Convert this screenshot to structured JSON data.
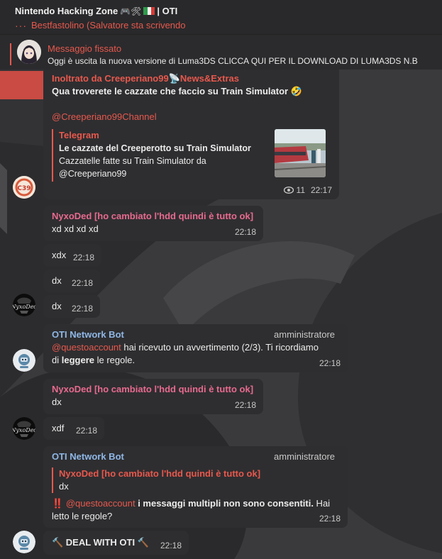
{
  "header": {
    "title": "Nintendo Hacking Zone",
    "title_emoji": "🎮🛠",
    "title_suffix": "| OTI",
    "typing_dots": "···",
    "typing_text": "Bestfastolino (Salvatore sta scrivendo"
  },
  "pinned": {
    "label": "Messaggio fissato",
    "text": "Oggi è uscita la nuova versione di Luma3DS  CLICCA QUI PER IL DOWNLOAD DI LUMA3DS  N.B"
  },
  "messages": {
    "forward": {
      "from": "Inoltrato da Creeperiano99📡News&Extras",
      "text": "Qua troverete le cazzate che faccio su Train Simulator 🤣",
      "channel": "@Creeperiano99Channel",
      "preview_site": "Telegram",
      "preview_title": "Le cazzate del Creeperotto su Train Simulator",
      "preview_desc": "Cazzatelle fatte su Train Simulator da @Creeperiano99",
      "views": "11",
      "time": "22:17"
    },
    "m1": {
      "sender": "NyxoDed [ho cambiato l'hdd quindi è tutto ok]",
      "text": "xd xd xd xd",
      "time": "22:18"
    },
    "m2": {
      "text": "xdx",
      "time": "22:18"
    },
    "m3": {
      "text": "dx",
      "time": "22:18"
    },
    "m4": {
      "text": "dx",
      "time": "22:18"
    },
    "bot1": {
      "sender": "OTI Network Bot",
      "role": "amministratore",
      "mention": "@questoaccount",
      "text_a": " hai ricevuto un avvertimento (2/3). Ti ricordiamo",
      "text_b": "di ",
      "bold": "leggere",
      "text_c": " le regole.",
      "time": "22:18"
    },
    "m5": {
      "sender": "NyxoDed [ho cambiato l'hdd quindi è tutto ok]",
      "text": "dx",
      "time": "22:18"
    },
    "m6": {
      "text": "xdf",
      "time": "22:18"
    },
    "bot2": {
      "sender": "OTI Network Bot",
      "role": "amministratore",
      "reply_sender": "NyxoDed [ho cambiato l'hdd quindi è tutto ok]",
      "reply_text": "dx",
      "alert": "‼️",
      "mention": "@questoaccount",
      "bold": " i messaggi multipli non sono consentiti.",
      "text_a": " Hai",
      "text_b": "letto le regole?",
      "time": "22:18"
    },
    "m7": {
      "text": "🔨 DEAL WITH OTI 🔨",
      "time": "22:18"
    }
  },
  "colors": {
    "accent": "#e8584d",
    "pink": "#e86a8f",
    "bot_blue": "#8fb7e6",
    "bubble": "#2e2e30",
    "header": "#29292b"
  }
}
